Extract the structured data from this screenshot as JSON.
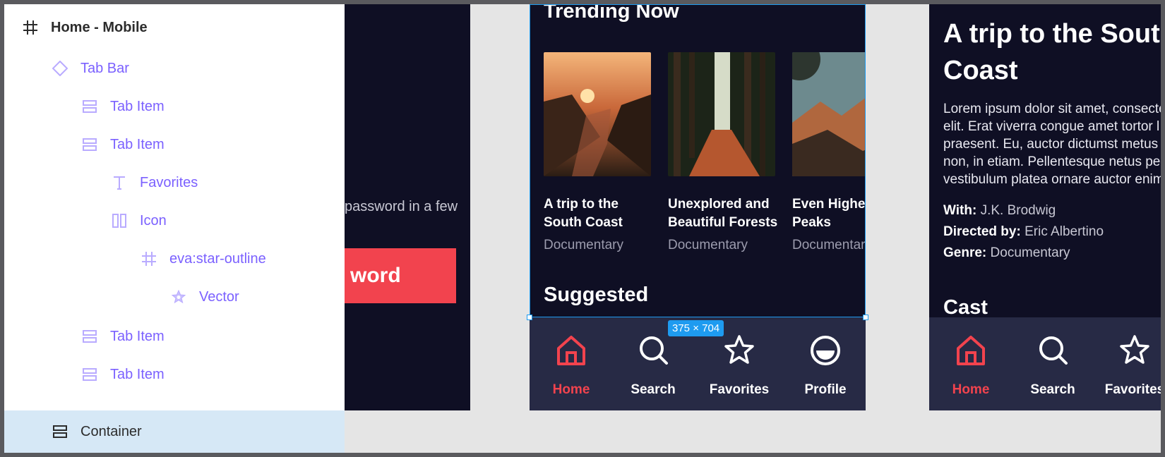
{
  "layers": {
    "root": "Home - Mobile",
    "items": [
      {
        "label": "Tab Bar",
        "icon": "component-icon",
        "depth": 1
      },
      {
        "label": "Tab Item",
        "icon": "auto-layout-icon",
        "depth": 2
      },
      {
        "label": "Tab Item",
        "icon": "auto-layout-icon",
        "depth": 2
      },
      {
        "label": "Favorites",
        "icon": "text-icon",
        "depth": 3
      },
      {
        "label": "Icon",
        "icon": "columns-icon",
        "depth": 3
      },
      {
        "label": "eva:star-outline",
        "icon": "frame-icon",
        "depth": 4
      },
      {
        "label": "Vector",
        "icon": "star-vector-icon",
        "depth": 5
      },
      {
        "label": "Tab Item",
        "icon": "auto-layout-icon",
        "depth": 2
      },
      {
        "label": "Tab Item",
        "icon": "auto-layout-icon",
        "depth": 2
      }
    ],
    "selected": "Container"
  },
  "frame_left": {
    "text": "password in a few",
    "button": "word"
  },
  "frame_home": {
    "trending_title": "Trending Now",
    "cards": [
      {
        "title_1": "A trip to the",
        "title_2": "South Coast",
        "genre": "Documentary"
      },
      {
        "title_1": "Unexplored and",
        "title_2": "Beautiful Forests",
        "genre": "Documentary"
      },
      {
        "title_1": "Even Higher",
        "title_2": "Peaks",
        "genre": "Documentary"
      }
    ],
    "suggested_title": "Suggested",
    "size_badge": "375 × 704"
  },
  "tabs": [
    "Home",
    "Search",
    "Favorites",
    "Profile"
  ],
  "active_tab": "Home",
  "frame_detail": {
    "title_1": "A trip to the South",
    "title_2": "Coast",
    "body": [
      "Lorem ipsum dolor sit amet, consectetur adipiscing",
      "elit. Erat viverra congue amet tortor l",
      "praesent. Eu, auctor dictumst metus",
      "non, in etiam. Pellentesque netus pe",
      "vestibulum platea ornare auctor enim"
    ],
    "with_label": "With:",
    "with_value": "J.K. Brodwig",
    "directed_label": "Directed by:",
    "directed_value": "Eric Albertino",
    "genre_label": "Genre:",
    "genre_value": "Documentary",
    "cast_title": "Cast"
  },
  "colors": {
    "accent": "#f2434e",
    "frame_bg": "#0f0f24",
    "tabbar_bg": "#272a45",
    "selection": "#1e9bf0",
    "layer_purple": "#7b61ff"
  }
}
